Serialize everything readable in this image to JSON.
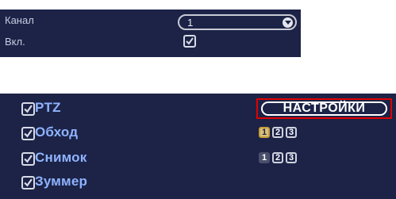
{
  "top": {
    "channel_label": "Канал",
    "channel_value": "1",
    "enable_label": "Вкл."
  },
  "bottom": {
    "ptz_label": "PTZ",
    "settings_button": "НАСТРОЙКИ",
    "patrol_label": "Обход",
    "patrol_values": [
      "1",
      "2",
      "3"
    ],
    "snapshot_label": "Снимок",
    "snapshot_values": [
      "1",
      "2",
      "3"
    ],
    "buzzer_label": "Зуммер"
  },
  "colors": {
    "panel_bg": "#1c2347",
    "highlight_red": "#e00000",
    "label_blue": "#8fb3ff"
  }
}
